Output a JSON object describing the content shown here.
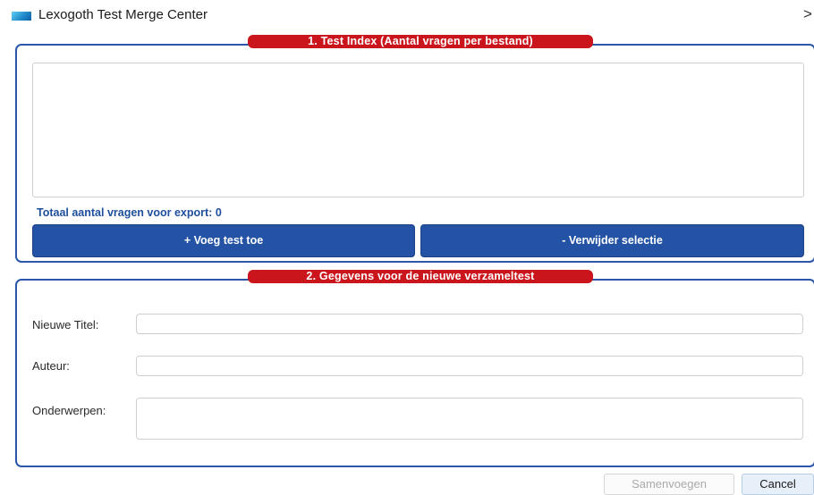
{
  "window": {
    "title": "Lexogoth Test Merge Center",
    "close_glyph": ">"
  },
  "section1": {
    "legend": "1. Test Index (Aantal vragen per bestand)",
    "total_label": "Totaal aantal vragen voor export: 0",
    "add_button": "+ Voeg test toe",
    "remove_button": "- Verwijder selectie"
  },
  "section2": {
    "legend": "2. Gegevens voor de nieuwe verzameltest",
    "title_label": "Nieuwe Titel:",
    "title_value": "",
    "author_label": "Auteur:",
    "author_value": "",
    "topics_label": "Onderwerpen:",
    "topics_value": ""
  },
  "footer": {
    "merge_button": "Samenvoegen",
    "cancel_button": "Cancel"
  },
  "colors": {
    "accent_blue": "#2453a6",
    "legend_red": "#c9151b",
    "label_blue": "#1e4f9d"
  }
}
